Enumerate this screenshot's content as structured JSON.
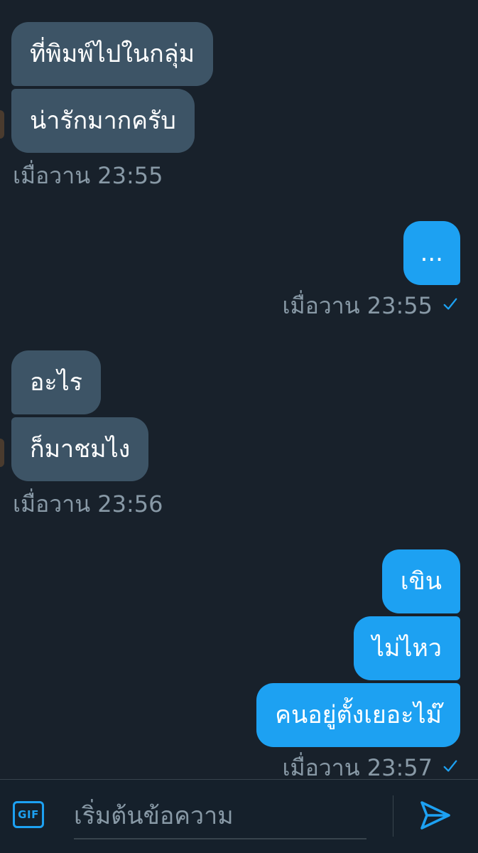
{
  "conversation": {
    "groups": [
      {
        "direction": "incoming",
        "messages": [
          "ที่พิมพ์ไปในกลุ่ม",
          "น่ารักมากครับ"
        ],
        "timestamp": "เมื่อวาน 23:55"
      },
      {
        "direction": "outgoing",
        "messages": [
          "..."
        ],
        "timestamp": "เมื่อวาน 23:55",
        "status_icon": "check-icon"
      },
      {
        "direction": "incoming",
        "messages": [
          "อะไร",
          "ก็มาชมไง"
        ],
        "timestamp": "เมื่อวาน 23:56"
      },
      {
        "direction": "outgoing",
        "messages": [
          "เขิน",
          "ไม่ไหว",
          "คนอยู่ตั้งเยอะไม๊"
        ],
        "timestamp": "เมื่อวาน 23:57",
        "status_icon": "check-icon"
      }
    ]
  },
  "composer": {
    "gif_label": "GIF",
    "placeholder": "เริ่มต้นข้อความ",
    "value": "",
    "send_icon": "send-icon"
  },
  "colors": {
    "background": "#18212b",
    "incoming_bubble": "#3d5466",
    "outgoing_bubble": "#1da1f2",
    "timestamp": "#8899a6",
    "accent": "#1da1f2"
  }
}
